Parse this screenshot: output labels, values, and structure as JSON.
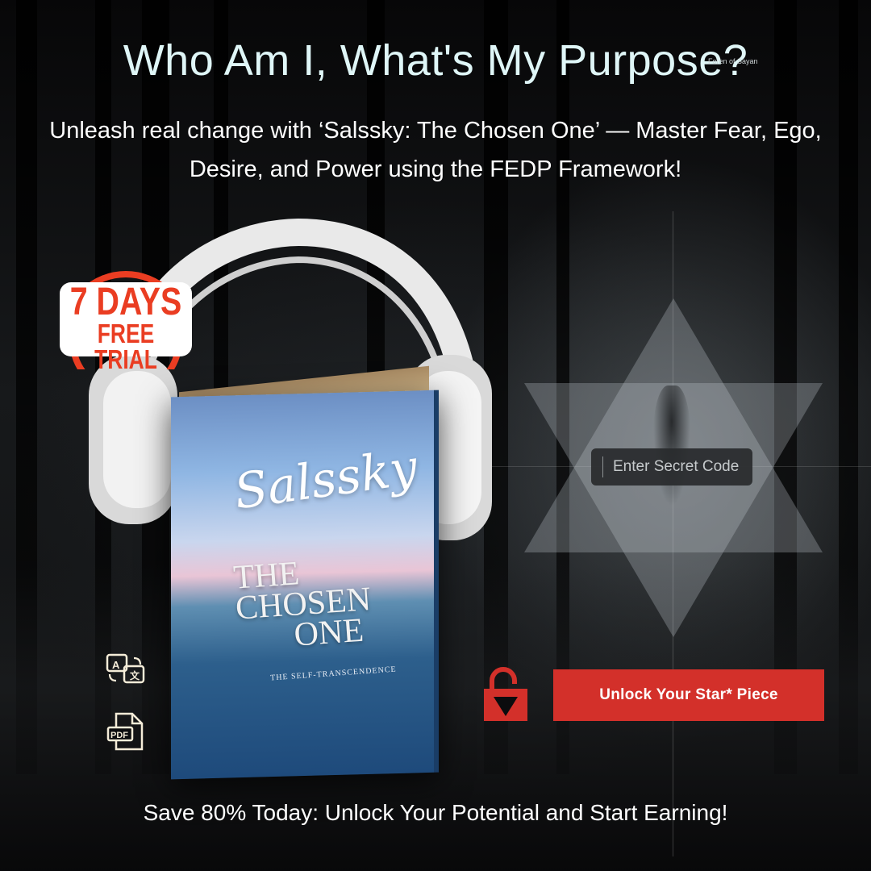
{
  "header": {
    "title": "Who Am I, What's My Purpose?",
    "subtitle": "Unleash real change with ‘Salssky: The Chosen One’ — Master Fear, Ego, Desire, and Power using the FEDP Framework!",
    "mark": "Foren of Sayan"
  },
  "badge": {
    "line1": "7 DAYS",
    "line2": "FREE TRIAL"
  },
  "book": {
    "author": "Salssky",
    "title_line1": "THE",
    "title_line2": "CHOSEN",
    "title_line3": "ONE",
    "subtitle": "THE SELF-TRANSCENDENCE"
  },
  "code_input": {
    "placeholder": "Enter Secret Code",
    "value": ""
  },
  "unlock_button": {
    "label": "Unlock Your Star* Piece"
  },
  "icons": {
    "translate": "translate-icon",
    "pdf": "pdf-icon",
    "pdf_label": "PDF",
    "lock": "unlocked-padlock-icon"
  },
  "footer": {
    "text": "Save 80% Today: Unlock Your Potential and Start Earning!"
  },
  "colors": {
    "accent_red": "#d3302a",
    "headline": "#dff6f7",
    "badge_orange": "#ea3d22"
  }
}
